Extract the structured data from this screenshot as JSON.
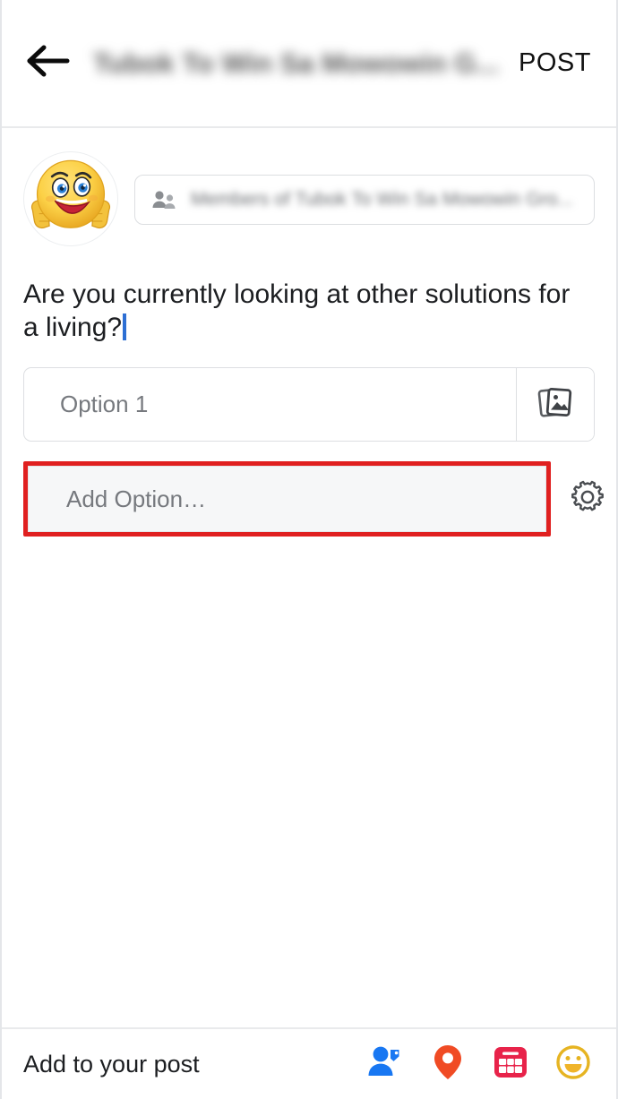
{
  "header": {
    "back_icon": "arrow-left-icon",
    "title": "Tubok To Win Sa Mowowin G...",
    "post_label": "POST"
  },
  "composer": {
    "avatar_icon": "smiley-thumbs-up-avatar",
    "audience": {
      "icon": "friends-group-icon",
      "label": "Members of Tubok To Win Sa Mowowin Gro..."
    },
    "post_text": "Are you currently looking at other solutions for a living?",
    "caret_color": "#2d6fd4"
  },
  "poll": {
    "options": [
      {
        "placeholder": "Option 1",
        "value": "",
        "image_icon": "photo-stack-icon"
      }
    ],
    "add_option": {
      "placeholder": "Add Option…",
      "value": "",
      "highlight_color": "#e02020"
    },
    "settings_icon": "gear-icon"
  },
  "bottom_bar": {
    "label": "Add to your post",
    "icons": [
      {
        "name": "tag-people-icon",
        "color": "#1877f2"
      },
      {
        "name": "location-pin-icon",
        "color": "#f04b24"
      },
      {
        "name": "gif-grid-icon",
        "color": "#e8234a"
      },
      {
        "name": "emoji-smiley-icon",
        "color": "#e6b422"
      }
    ]
  }
}
